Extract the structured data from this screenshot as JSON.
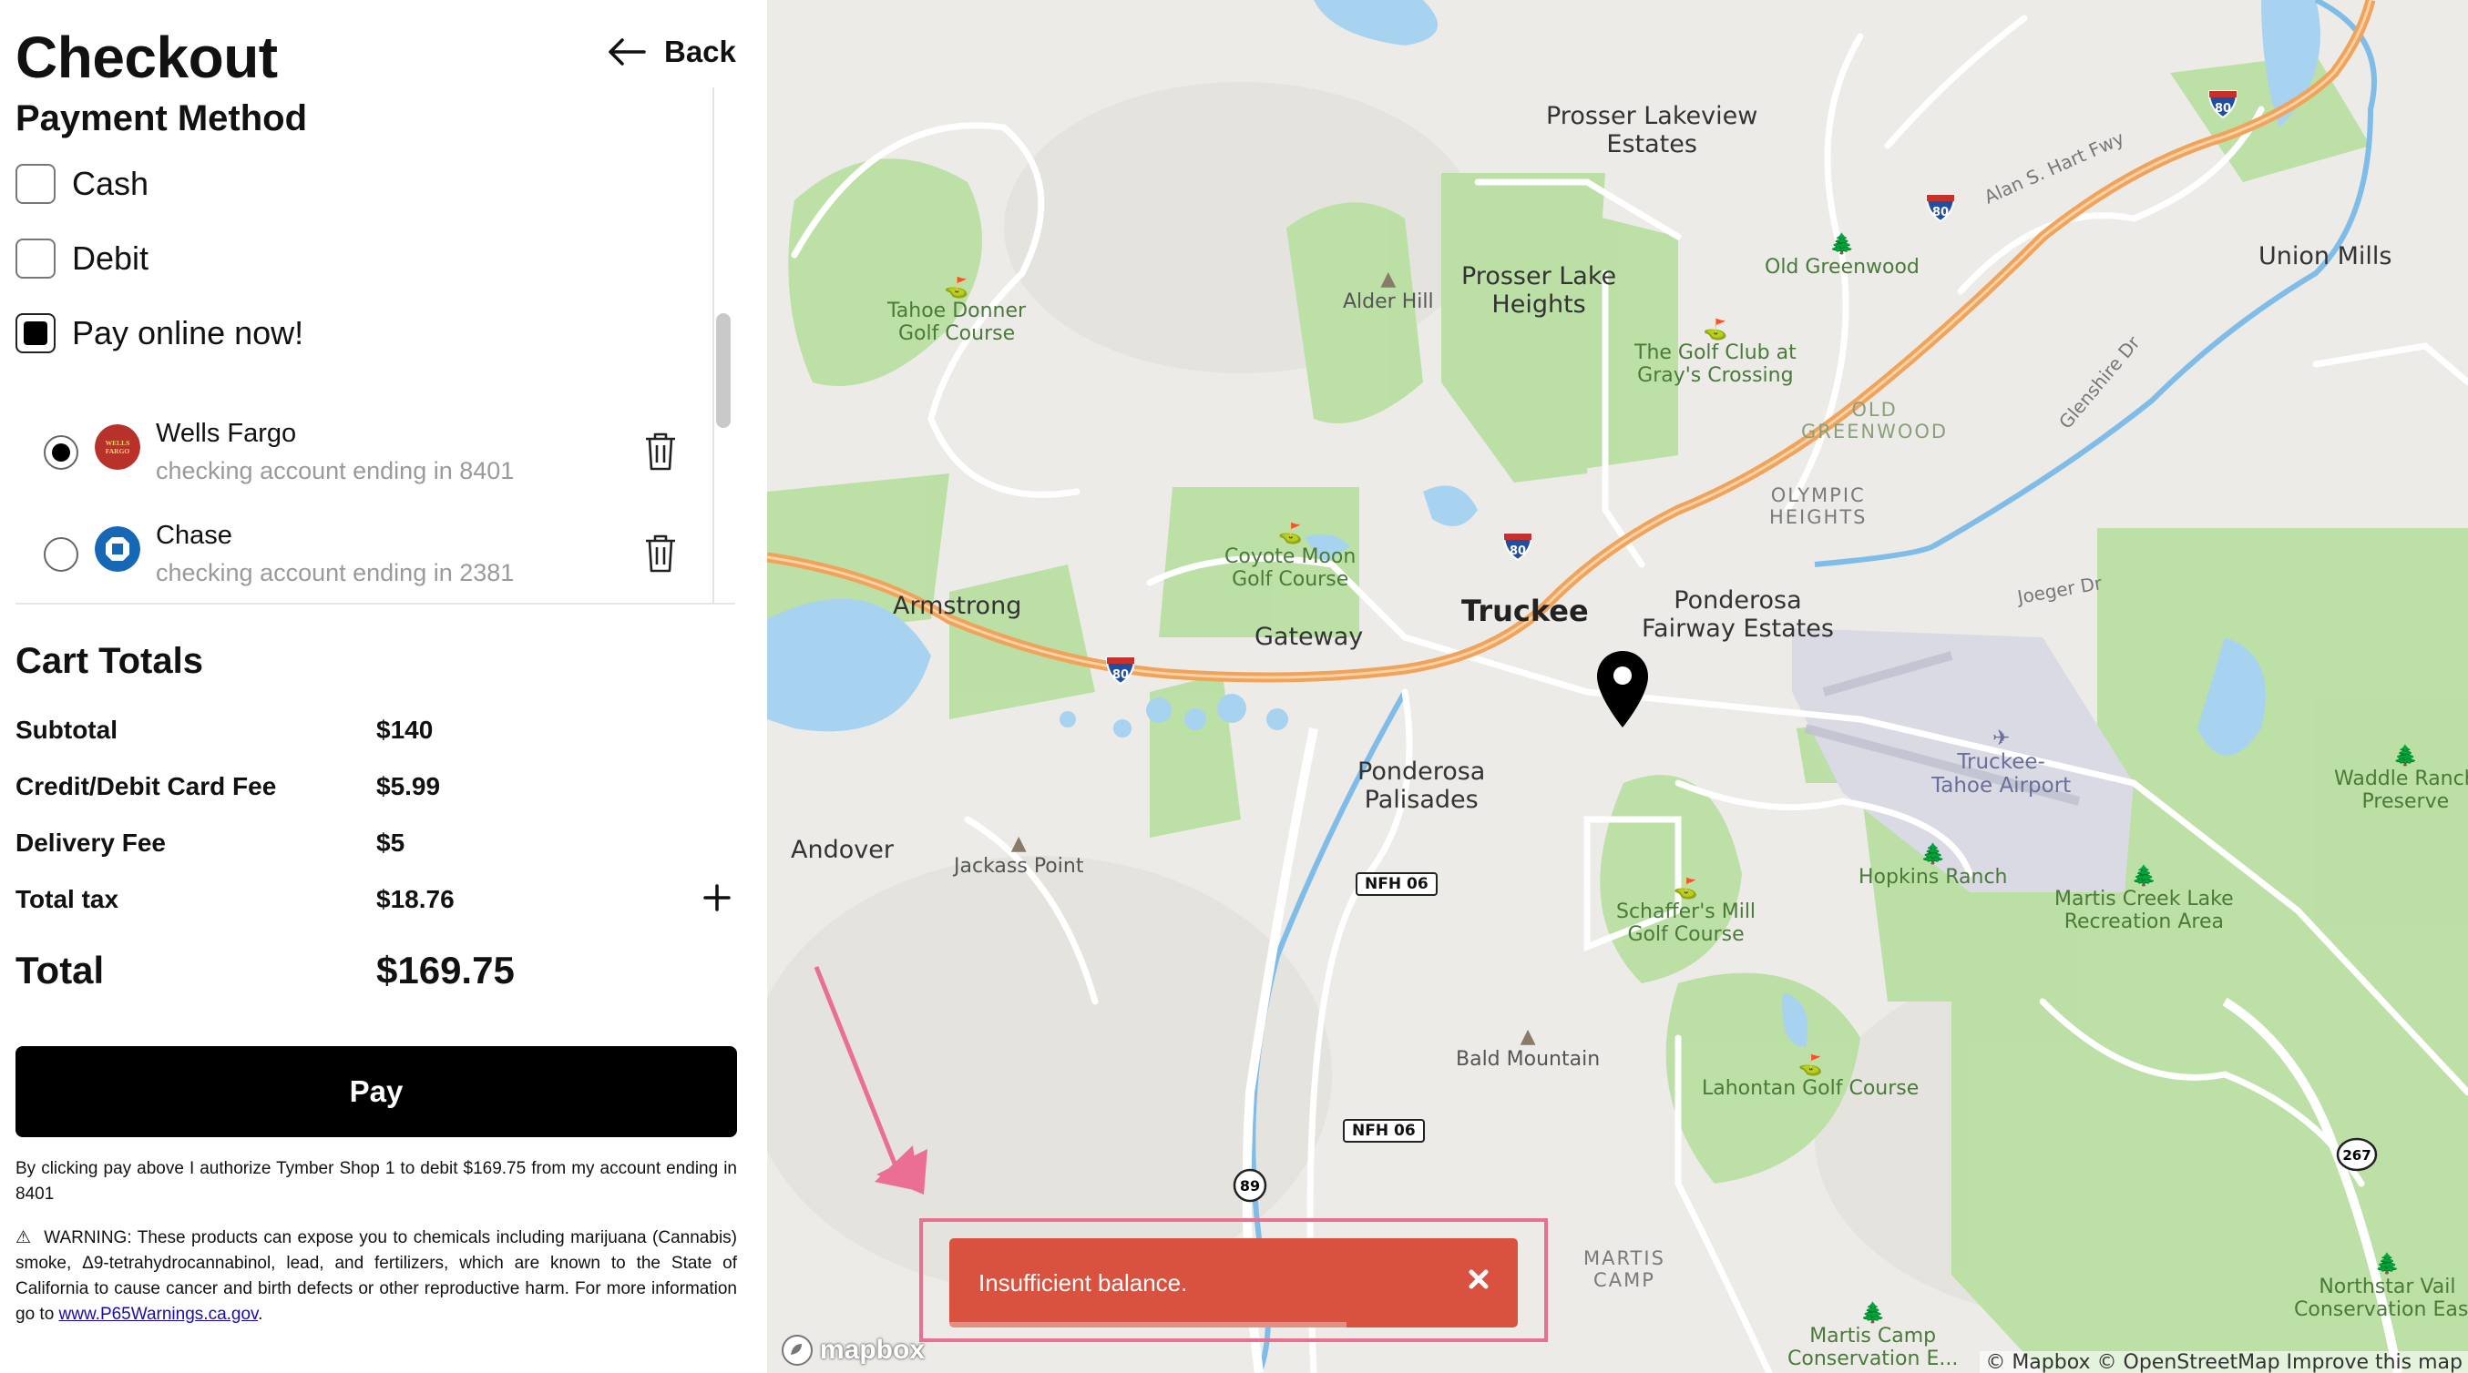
{
  "header": {
    "title": "Checkout",
    "back_label": "Back"
  },
  "payment": {
    "title": "Payment Method",
    "options": [
      {
        "label": "Cash",
        "checked": false
      },
      {
        "label": "Debit",
        "checked": false
      },
      {
        "label": "Pay online now!",
        "checked": true
      }
    ],
    "accounts": [
      {
        "bank": "Wells Fargo",
        "detail": "checking account ending in 8401",
        "selected": true,
        "logo_color": "#b9312b",
        "logo_text": "WELLS FARGO"
      },
      {
        "bank": "Chase",
        "detail": "checking account ending in 2381",
        "selected": false,
        "logo_color": "#1668b6"
      }
    ]
  },
  "cart": {
    "title": "Cart Totals",
    "rows": [
      {
        "label": "Subtotal",
        "value": "$140"
      },
      {
        "label": "Credit/Debit Card Fee",
        "value": "$5.99"
      },
      {
        "label": "Delivery Fee",
        "value": "$5"
      },
      {
        "label": "Total tax",
        "value": "$18.76"
      }
    ],
    "total_label": "Total",
    "total_value": "$169.75",
    "pay_label": "Pay"
  },
  "legal": {
    "authorization": "By clicking pay above I authorize Tymber Shop 1 to debit $169.75 from my account ending in 8401",
    "warning_icon": "⚠",
    "warning": "WARNING: These products can expose you to chemicals including marijuana (Cannabis) smoke, Δ9-tetrahydrocannabinol, lead, and fertilizers, which are known to the State of California to cause cancer and birth defects or other reproductive harm. For more information go to",
    "link": "www.P65Warnings.ca.gov",
    "end": "."
  },
  "map": {
    "labels": {
      "prosser_lakeview": [
        "Prosser Lakeview",
        "Estates"
      ],
      "prosser_lake_heights": [
        "Prosser Lake",
        "Heights"
      ],
      "alder_hill": "Alder Hill",
      "tahoe_donner": [
        "Tahoe Donner",
        "Golf Course"
      ],
      "old_greenwood": "Old Greenwood",
      "golf_club": [
        "The Golf Club at",
        "Gray's Crossing"
      ],
      "old_greenwood_caps": [
        "OLD",
        "GREENWOOD"
      ],
      "union_mills": "Union Mills",
      "alan_hart": "Alan S. Hart Fwy",
      "glenshire": "Glenshire Dr",
      "olympic_heights": [
        "OLYMPIC",
        "HEIGHTS"
      ],
      "coyote_moon": [
        "Coyote Moon",
        "Golf Course"
      ],
      "armstrong": "Armstrong",
      "gateway": "Gateway",
      "truckee": "Truckee",
      "ponderosa_fairway": [
        "Ponderosa",
        "Fairway Estates"
      ],
      "joeger": "Joeger Dr",
      "ponderosa_palisades": [
        "Ponderosa",
        "Palisades"
      ],
      "truckee_airport": [
        "Truckee-",
        "Tahoe Airport"
      ],
      "waddle_ranch": [
        "Waddle Ranch",
        "Preserve"
      ],
      "andover": "Andover",
      "jackass_point": "Jackass Point",
      "nfh06": "NFH 06",
      "hopkins_ranch": "Hopkins Ranch",
      "martis_creek_lake": [
        "Martis Creek Lake",
        "Recreation Area"
      ],
      "schaffers_mill": [
        "Schaffer's Mill",
        "Golf Course"
      ],
      "bald_mountain": "Bald Mountain",
      "lahontan": "Lahontan Golf Course",
      "martis_camp_caps": [
        "MARTIS",
        "CAMP"
      ],
      "martis_camp": [
        "Martis Camp",
        "Conservation E..."
      ],
      "northstar": [
        "Northstar Vail",
        "Conservation Ease"
      ],
      "hwy89": "89",
      "hwy267": "267",
      "i80": "80"
    },
    "toast": {
      "message": "Insufficient balance.",
      "close_icon": "close-icon"
    },
    "logo": "mapbox",
    "attribution": "© Mapbox © OpenStreetMap  Improve this map"
  },
  "colors": {
    "accent": "#000000",
    "toast": "#d9523f",
    "highlight": "#e8718f",
    "interstate": "#f0a35a",
    "water": "#a8d3f0",
    "park": "#a6d98a"
  }
}
